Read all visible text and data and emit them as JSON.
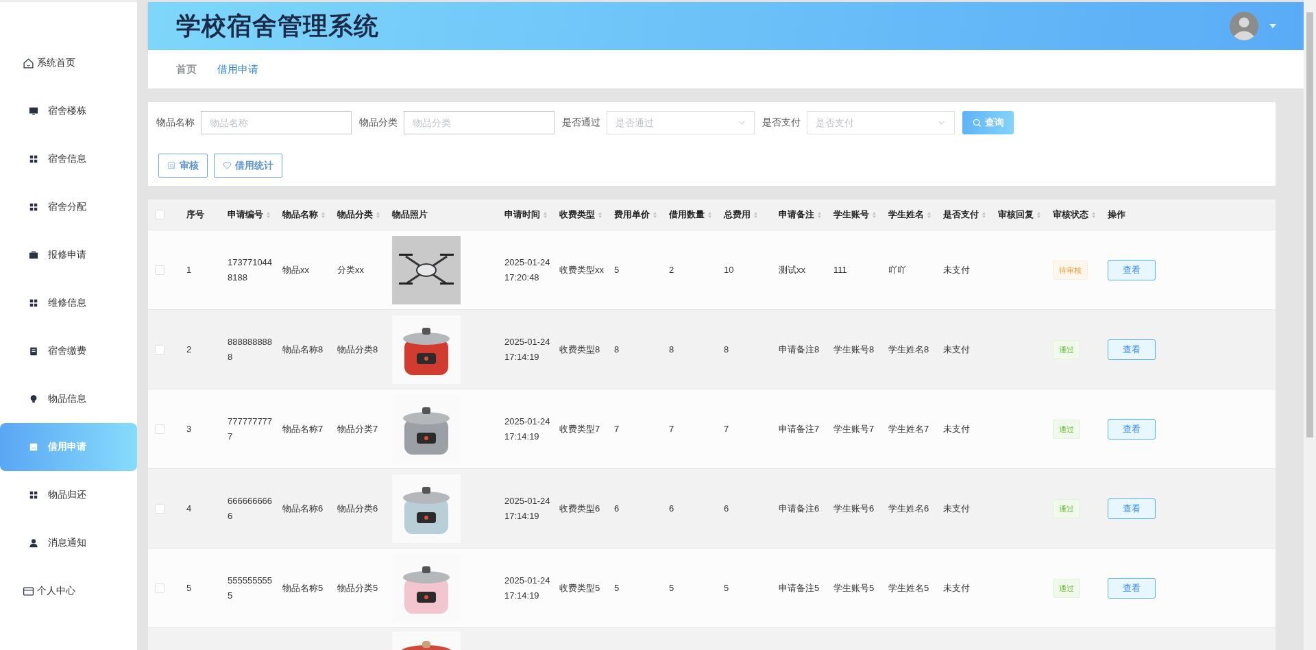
{
  "sidebar": {
    "items": [
      {
        "label": "系统首页",
        "selected": false
      },
      {
        "label": "宿舍楼栋",
        "selected": false
      },
      {
        "label": "宿舍信息",
        "selected": false
      },
      {
        "label": "宿舍分配",
        "selected": false
      },
      {
        "label": "报修申请",
        "selected": false
      },
      {
        "label": "维修信息",
        "selected": false
      },
      {
        "label": "宿舍缴费",
        "selected": false
      },
      {
        "label": "物品信息",
        "selected": false
      },
      {
        "label": "借用申请",
        "selected": true
      },
      {
        "label": "物品归还",
        "selected": false
      },
      {
        "label": "消息通知",
        "selected": false
      },
      {
        "label": "个人中心",
        "selected": false
      }
    ]
  },
  "header": {
    "title": "学校宿舍管理系统"
  },
  "breadcrumb": [
    {
      "label": "首页",
      "selected": false
    },
    {
      "label": "借用申请",
      "selected": true
    }
  ],
  "filters": [
    {
      "label": "物品名称",
      "placeholder": "物品名称",
      "kind": "input"
    },
    {
      "label": "物品分类",
      "placeholder": "物品分类",
      "kind": "input"
    },
    {
      "label": "是否通过",
      "placeholder": "是否通过",
      "kind": "select"
    },
    {
      "label": "是否支付",
      "placeholder": "是否支付",
      "kind": "select"
    }
  ],
  "search_button": "查询",
  "actions": [
    {
      "label": "审核",
      "kind": "review"
    },
    {
      "label": "借用统计",
      "kind": "stats"
    }
  ],
  "table": {
    "select_all": {
      "checked": false
    },
    "columns": [
      {
        "label": "序号",
        "sortable": false
      },
      {
        "label": "申请编号",
        "sortable": true
      },
      {
        "label": "物品名称",
        "sortable": true
      },
      {
        "label": "物品分类",
        "sortable": true
      },
      {
        "label": "物品照片",
        "sortable": false
      },
      {
        "label": "申请时间",
        "sortable": true
      },
      {
        "label": "收费类型",
        "sortable": true
      },
      {
        "label": "费用单价",
        "sortable": true
      },
      {
        "label": "借用数量",
        "sortable": true
      },
      {
        "label": "总费用",
        "sortable": true
      },
      {
        "label": "申请备注",
        "sortable": true
      },
      {
        "label": "学生账号",
        "sortable": true
      },
      {
        "label": "学生姓名",
        "sortable": true
      },
      {
        "label": "是否支付",
        "sortable": true
      },
      {
        "label": "审核回复",
        "sortable": true
      },
      {
        "label": "审核状态",
        "sortable": true
      },
      {
        "label": "操作",
        "sortable": false
      }
    ],
    "rows": [
      {
        "checked": false,
        "index": "1",
        "code": "1737710448188",
        "name": "物品xx",
        "category": "分类xx",
        "time": "2025-01-24 17:20:48",
        "fee_type": "收费类型xx",
        "unit_price": "5",
        "quantity": "2",
        "total": "10",
        "remark": "测试xx",
        "account": "111",
        "student": "吖吖",
        "paid": "未支付",
        "status": {
          "label": "待审核",
          "kind": "pending"
        },
        "action": "查看"
      },
      {
        "checked": false,
        "index": "2",
        "code": "8888888888",
        "name": "物品名称8",
        "category": "物品分类8",
        "time": "2025-01-24 17:14:19",
        "fee_type": "收费类型8",
        "unit_price": "8",
        "quantity": "8",
        "total": "8",
        "remark": "申请备注8",
        "account": "学生账号8",
        "student": "学生姓名8",
        "paid": "未支付",
        "status": {
          "label": "通过",
          "kind": "passed"
        },
        "action": "查看"
      },
      {
        "checked": false,
        "index": "3",
        "code": "7777777777",
        "name": "物品名称7",
        "category": "物品分类7",
        "time": "2025-01-24 17:14:19",
        "fee_type": "收费类型7",
        "unit_price": "7",
        "quantity": "7",
        "total": "7",
        "remark": "申请备注7",
        "account": "学生账号7",
        "student": "学生姓名7",
        "paid": "未支付",
        "status": {
          "label": "通过",
          "kind": "passed"
        },
        "action": "查看"
      },
      {
        "checked": false,
        "index": "4",
        "code": "6666666666",
        "name": "物品名称6",
        "category": "物品分类6",
        "time": "2025-01-24 17:14:19",
        "fee_type": "收费类型6",
        "unit_price": "6",
        "quantity": "6",
        "total": "6",
        "remark": "申请备注6",
        "account": "学生账号6",
        "student": "学生姓名6",
        "paid": "未支付",
        "status": {
          "label": "通过",
          "kind": "passed"
        },
        "action": "查看"
      },
      {
        "checked": false,
        "index": "5",
        "code": "5555555555",
        "name": "物品名称5",
        "category": "物品分类5",
        "time": "2025-01-24 17:14:19",
        "fee_type": "收费类型5",
        "unit_price": "5",
        "quantity": "5",
        "total": "5",
        "remark": "申请备注5",
        "account": "学生账号5",
        "student": "学生姓名5",
        "paid": "未支付",
        "status": {
          "label": "通过",
          "kind": "passed"
        },
        "action": "查看"
      }
    ]
  }
}
